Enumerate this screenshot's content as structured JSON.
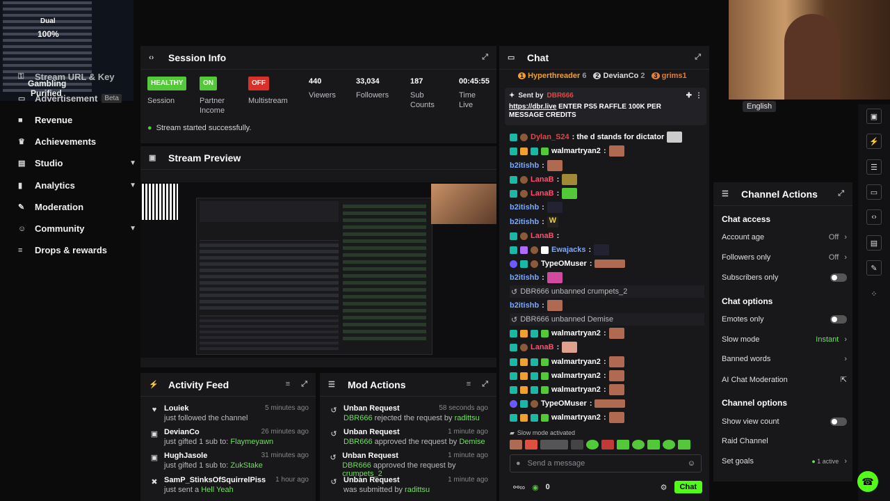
{
  "overlay": {
    "mode": "Dual",
    "percent": "100%",
    "caption_1": "Gambling",
    "caption_2": "Purified"
  },
  "sidebar": {
    "items": [
      {
        "label": "Stream URL & Key",
        "icon": "key-icon"
      },
      {
        "label": "Advertisement",
        "badge": "Beta",
        "icon": "ad-icon"
      },
      {
        "label": "Revenue",
        "icon": "dollar-icon"
      },
      {
        "label": "Achievements",
        "icon": "trophy-icon"
      },
      {
        "label": "Studio",
        "icon": "studio-icon"
      },
      {
        "label": "Analytics",
        "icon": "chart-icon"
      },
      {
        "label": "Moderation",
        "icon": "wrench-icon"
      },
      {
        "label": "Community",
        "icon": "people-icon"
      },
      {
        "label": "Drops & rewards",
        "icon": "gift-icon"
      }
    ]
  },
  "session": {
    "title": "Session Info",
    "stats": [
      {
        "value": "HEALTHY",
        "label": "Session",
        "color": "#53c93a"
      },
      {
        "value": "ON",
        "label": "Partner Income",
        "color": "#53c93a"
      },
      {
        "value": "OFF",
        "label": "Multistream",
        "color": "#d9302a"
      },
      {
        "value": "440",
        "label": "Viewers"
      },
      {
        "value": "33,034",
        "label": "Followers"
      },
      {
        "value": "187",
        "label": "Sub Counts"
      },
      {
        "value": "00:45:55",
        "label": "Time Live"
      }
    ],
    "status": "Stream started successfully."
  },
  "preview": {
    "title": "Stream Preview"
  },
  "activity": {
    "title": "Activity Feed",
    "items": [
      {
        "name": "Louiek",
        "action": "just followed the channel",
        "extra": "",
        "time": "5 minutes ago",
        "icon": "heart-icon"
      },
      {
        "name": "DevianCo",
        "action": "just gifted 1 sub to:",
        "extra": "Flaymeyawn",
        "time": "26 minutes ago",
        "icon": "gift-icon"
      },
      {
        "name": "HughJasole",
        "action": "just gifted 1 sub to:",
        "extra": "ZukStake",
        "time": "31 minutes ago",
        "icon": "gift-icon"
      },
      {
        "name": "SamP_StinksOfSquirrelPiss",
        "action": "just sent a",
        "extra": "Hell Yeah",
        "time": "1 hour ago",
        "icon": "kick-icon"
      }
    ]
  },
  "mod": {
    "title": "Mod Actions",
    "items": [
      {
        "title": "Unban Request",
        "who": "DBR666",
        "desc": "rejected the request by",
        "target": "radittsu",
        "time": "58 seconds ago"
      },
      {
        "title": "Unban Request",
        "who": "DBR666",
        "desc": "approved the request by",
        "target": "Demise",
        "time": "1 minute ago"
      },
      {
        "title": "Unban Request",
        "who": "DBR666",
        "desc": "approved the request by",
        "target": "crumpets_2",
        "time": "1 minute ago"
      },
      {
        "title": "Unban Request",
        "who": "",
        "desc": "was submitted by",
        "target": "radittsu",
        "time": "1 minute ago"
      }
    ]
  },
  "chat": {
    "title": "Chat",
    "top_gifters": [
      {
        "rank": "1",
        "name": "Hyperthreader",
        "count": "6",
        "color": "#f0a030"
      },
      {
        "rank": "2",
        "name": "DevianCo",
        "count": "2",
        "color": "#cfcfcf"
      },
      {
        "rank": "3",
        "name": "grims1",
        "count": "",
        "color": "#e0803a"
      }
    ],
    "pinned": {
      "sent_by": "Sent by",
      "sender": "DBR666",
      "link": "https://dbr.live",
      "text": "ENTER PS5 RAFFLE 100K PER MESSAGE CREDITS"
    },
    "messages": [
      {
        "user": "Dylan_S24",
        "color": "#e04848",
        "text": ": the d stands for dictator"
      },
      {
        "user": "walmartryan2",
        "color": "#ffffff",
        "text": ":"
      },
      {
        "user": "b2itishb",
        "color": "#7aa8ff",
        "text": ":"
      },
      {
        "user": "LanaB",
        "color": "#ff4d6d",
        "text": ":"
      },
      {
        "user": "LanaB",
        "color": "#ff4d6d",
        "text": ":"
      },
      {
        "user": "b2itishb",
        "color": "#7aa8ff",
        "text": ":"
      },
      {
        "user": "b2itishb",
        "color": "#7aa8ff",
        "text": ":"
      },
      {
        "user": "LanaB",
        "color": "#ff4d6d",
        "text": ":"
      },
      {
        "user": "Ewajacks",
        "color": "#7aa8ff",
        "text": ":"
      },
      {
        "user": "TypeOMuser",
        "color": "#ffffff",
        "text": ":"
      },
      {
        "user": "b2itishb",
        "color": "#7aa8ff",
        "text": ":"
      },
      {
        "system": "DBR666 unbanned crumpets_2"
      },
      {
        "user": "b2itishb",
        "color": "#7aa8ff",
        "text": ":"
      },
      {
        "system": "DBR666 unbanned Demise"
      },
      {
        "user": "walmartryan2",
        "color": "#ffffff",
        "text": ":"
      },
      {
        "user": "LanaB",
        "color": "#ff4d6d",
        "text": ":"
      },
      {
        "user": "walmartryan2",
        "color": "#ffffff",
        "text": ":"
      },
      {
        "user": "walmartryan2",
        "color": "#ffffff",
        "text": ":"
      },
      {
        "user": "walmartryan2",
        "color": "#ffffff",
        "text": ":"
      },
      {
        "user": "TypeOMuser",
        "color": "#ffffff",
        "text": ":"
      },
      {
        "user": "walmartryan2",
        "color": "#ffffff",
        "text": ":"
      }
    ],
    "slow_mode": "Slow mode activated",
    "input_placeholder": "Send a message",
    "viewer_count": "0",
    "send_label": "Chat"
  },
  "webcam": {
    "language": "English"
  },
  "channel_actions": {
    "title": "Channel Actions",
    "chat_access": "Chat access",
    "account_age": {
      "label": "Account age",
      "value": "Off"
    },
    "followers_only": {
      "label": "Followers only",
      "value": "Off"
    },
    "subscribers_only": {
      "label": "Subscribers only"
    },
    "chat_options": "Chat options",
    "emotes_only": {
      "label": "Emotes only"
    },
    "slow_mode": {
      "label": "Slow mode",
      "value": "Instant"
    },
    "banned_words": {
      "label": "Banned words"
    },
    "ai_moderation": {
      "label": "AI Chat Moderation"
    },
    "channel_options": "Channel options",
    "show_view_count": {
      "label": "Show view count"
    },
    "raid_channel": {
      "label": "Raid Channel"
    },
    "set_goals": {
      "label": "Set goals",
      "value": "1 active"
    }
  }
}
